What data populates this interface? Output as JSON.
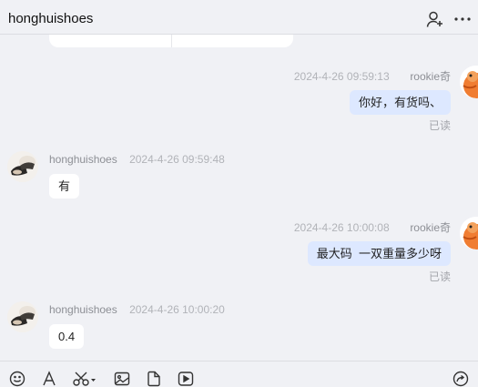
{
  "header": {
    "title": "honghuishoes",
    "actions": [
      {
        "name": "add-member-icon"
      },
      {
        "name": "more-icon"
      }
    ]
  },
  "messages": [
    {
      "side": "right",
      "sender": "rookie奇",
      "time": "2024-4-26 09:59:13",
      "text": "你好，有货吗、",
      "status": "已读"
    },
    {
      "side": "left",
      "sender": "honghuishoes",
      "time": "2024-4-26 09:59:48",
      "text": "有"
    },
    {
      "side": "right",
      "sender": "rookie奇",
      "time": "2024-4-26 10:00:08",
      "text": "最大码  一双重量多少呀",
      "status": "已读"
    },
    {
      "side": "left",
      "sender": "honghuishoes",
      "time": "2024-4-26 10:00:20",
      "text": "0.4"
    }
  ],
  "toolbar": {
    "icons": [
      "emoji-icon",
      "font-icon",
      "scissors-icon",
      "image-icon",
      "file-icon",
      "video-icon",
      "share-icon"
    ]
  },
  "colors": {
    "background": "#f0f1f5",
    "bubble_self": "#dde8ff",
    "bubble_other": "#ffffff",
    "avatar_self": "#f07d32"
  }
}
